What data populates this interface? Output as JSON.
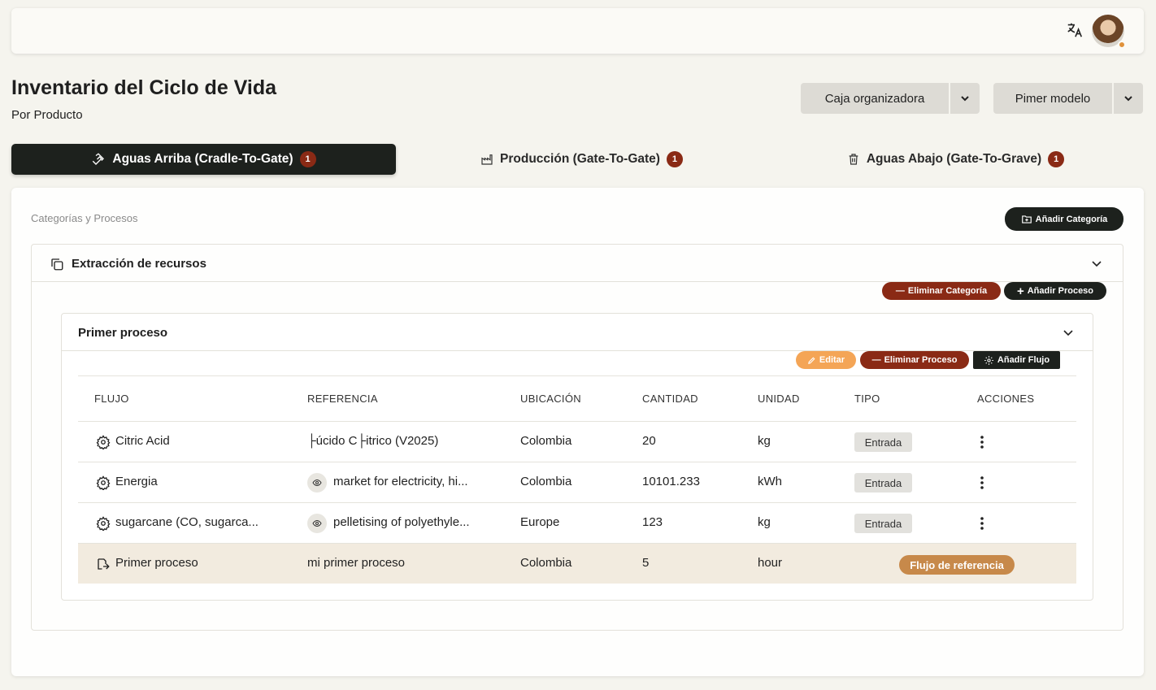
{
  "header": {
    "language_icon": "translate-icon",
    "avatar_icon": "user-avatar",
    "status_color": "#e0913a"
  },
  "page": {
    "title": "Inventario del Ciclo de Vida",
    "subtitle": "Por Producto"
  },
  "selectors": {
    "box": "Caja organizadora",
    "model": "Pimer modelo"
  },
  "tabs": [
    {
      "label": "Aguas Arriba (Cradle-To-Gate)",
      "count": "1",
      "icon": "hand-icon"
    },
    {
      "label": "Producción (Gate-To-Gate)",
      "count": "1",
      "icon": "factory-icon"
    },
    {
      "label": "Aguas Abajo (Gate-To-Grave)",
      "count": "1",
      "icon": "trash-icon"
    }
  ],
  "section": {
    "label": "Categorías y Procesos",
    "add_category": "Añadir Categoría"
  },
  "category": {
    "title": "Extracción de recursos",
    "delete_label": "Eliminar Categoría",
    "add_process_label": "Añadir Proceso"
  },
  "process": {
    "title": "Primer proceso",
    "edit_label": "Editar",
    "delete_label": "Eliminar Proceso",
    "add_flow_label": "Añadir Flujo"
  },
  "table": {
    "headers": [
      "FLUJO",
      "REFERENCIA",
      "UBICACIÓN",
      "CANTIDAD",
      "UNIDAD",
      "TIPO",
      "ACCIONES"
    ],
    "rows": [
      {
        "flow": "Citric Acid",
        "reference": "├úcido C├itrico (V2025)",
        "location": "Colombia",
        "quantity": "20",
        "unit": "kg",
        "type": "Entrada"
      },
      {
        "flow": "Energia",
        "reference": "market for electricity, hi...",
        "location": "Colombia",
        "quantity": "10101.233",
        "unit": "kWh",
        "type": "Entrada"
      },
      {
        "flow": "sugarcane (CO, sugarca...",
        "reference": "pelletising of polyethyle...",
        "location": "Europe",
        "quantity": "123",
        "unit": "kg",
        "type": "Entrada"
      }
    ],
    "reference_row": {
      "flow": "Primer proceso",
      "reference": "mi primer proceso",
      "location": "Colombia",
      "quantity": "5",
      "unit": "hour",
      "type": "Flujo de referencia"
    }
  }
}
